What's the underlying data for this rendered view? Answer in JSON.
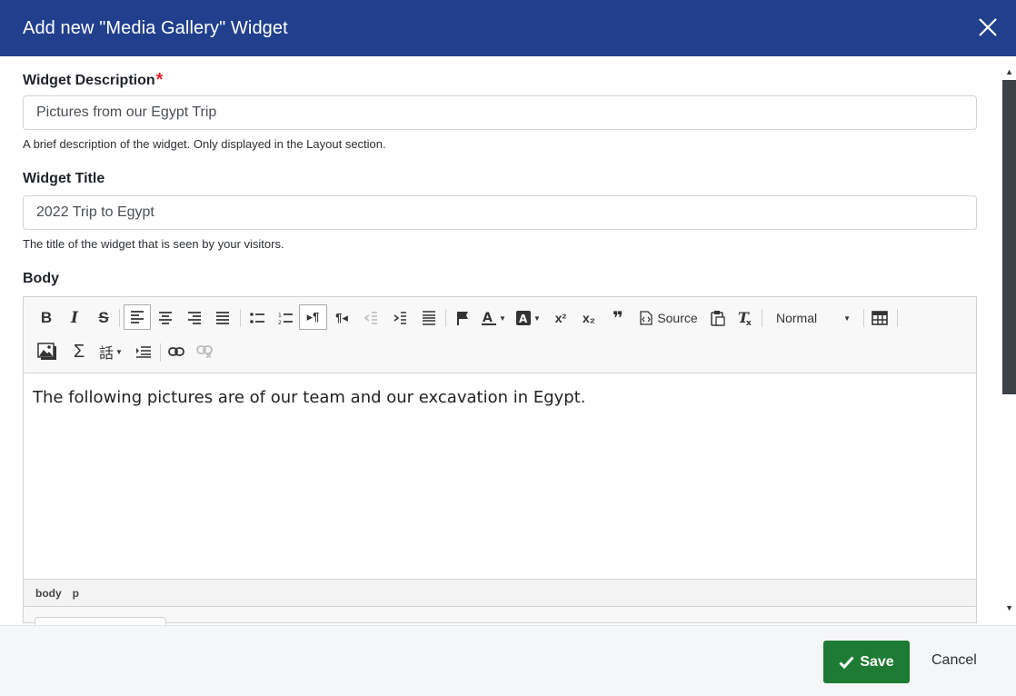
{
  "dialog": {
    "title": "Add new \"Media Gallery\" Widget",
    "close_icon": "close-icon"
  },
  "fields": {
    "description": {
      "label": "Widget Description",
      "required_marker": "*",
      "value": "Pictures from our Egypt Trip",
      "help": "A brief description of the widget. Only displayed in the Layout section."
    },
    "title": {
      "label": "Widget Title",
      "value": "2022 Trip to Egypt",
      "help": "The title of the widget that is seen by your visitors."
    },
    "body": {
      "label": "Body"
    }
  },
  "toolbar": {
    "bold": "B",
    "italic": "I",
    "strike": "S",
    "source_label": "Source",
    "format_value": "Normal",
    "sigma": "Σ",
    "language": "話",
    "superscript": "x²",
    "subscript": "x₂",
    "quote": "❞",
    "active_button": "align-left"
  },
  "editor": {
    "content": "The following pictures are of our team and our excavation in Egypt.",
    "path": [
      "body",
      "p"
    ]
  },
  "footer": {
    "save_label": "Save",
    "cancel_label": "Cancel"
  },
  "colors": {
    "header": "#213f8c",
    "save": "#1e7b34",
    "required": "#e0232f"
  }
}
